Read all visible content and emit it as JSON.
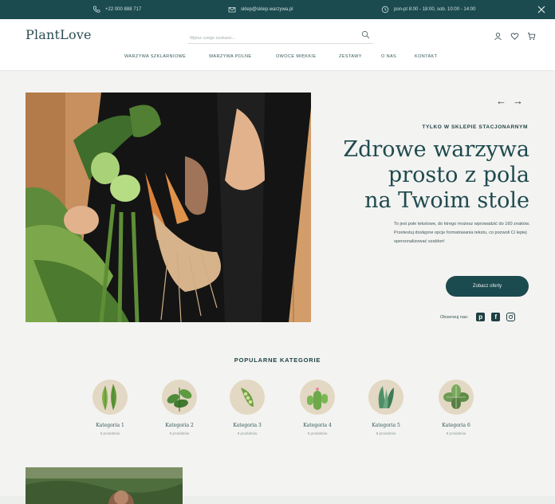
{
  "topbar": {
    "phone": "+22 000 888 717",
    "email": "sklep@sklep.warzywa.pl",
    "hours": "pon-pt 8:00 - 18:00, sob. 10:00 - 14:00"
  },
  "header": {
    "logo": "PlantLove",
    "search_placeholder": "Wpisz czego szukasz...",
    "nav": [
      "WARZYWA SZKLARNIOWE",
      "WARZYWA POLNE",
      "OWOCE MIĘKKIE",
      "ZESTAWY",
      "O NAS",
      "KONTAKT"
    ]
  },
  "hero": {
    "kicker": "TYLKO W SKLEPIE STACJONARNYM",
    "headline_lines": [
      "Zdrowe warzywa",
      "prosto z pola",
      "na Twoim stole"
    ],
    "lead": "To jest pole tekstowe, do ktrego możesz wprowadzić do 160 znaków. Przetestuj dostępne opcje formatowania tekstu, co pozwoli Ci lepiej spersonalizować szablon!",
    "cta": "Zobacz oferty",
    "follow_label": "Obserwuj nas:",
    "arrow_prev": "←",
    "arrow_next": "→"
  },
  "categories": {
    "title": "POPULARNE KATEGORIE",
    "items": [
      {
        "name": "Kategoria 1",
        "count": "8 produktów"
      },
      {
        "name": "Kategoria 2",
        "count": "8 produktów"
      },
      {
        "name": "Kategoria 3",
        "count": "8 produktów"
      },
      {
        "name": "Kategoria 4",
        "count": "8 produktów"
      },
      {
        "name": "Kategoria 5",
        "count": "8 produktów"
      },
      {
        "name": "Kategoria 6",
        "count": "8 produktów"
      }
    ]
  },
  "colors": {
    "primary": "#1b4a4f",
    "background": "#f3f3f1",
    "category_circle": "#e3d8c3"
  },
  "icons": {
    "topbar": [
      "phone-icon",
      "mail-icon",
      "clock-icon",
      "close-icon"
    ],
    "header": [
      "search-icon",
      "user-icon",
      "heart-icon",
      "cart-icon"
    ],
    "social": [
      "pinterest-icon",
      "facebook-icon",
      "instagram-icon"
    ]
  }
}
